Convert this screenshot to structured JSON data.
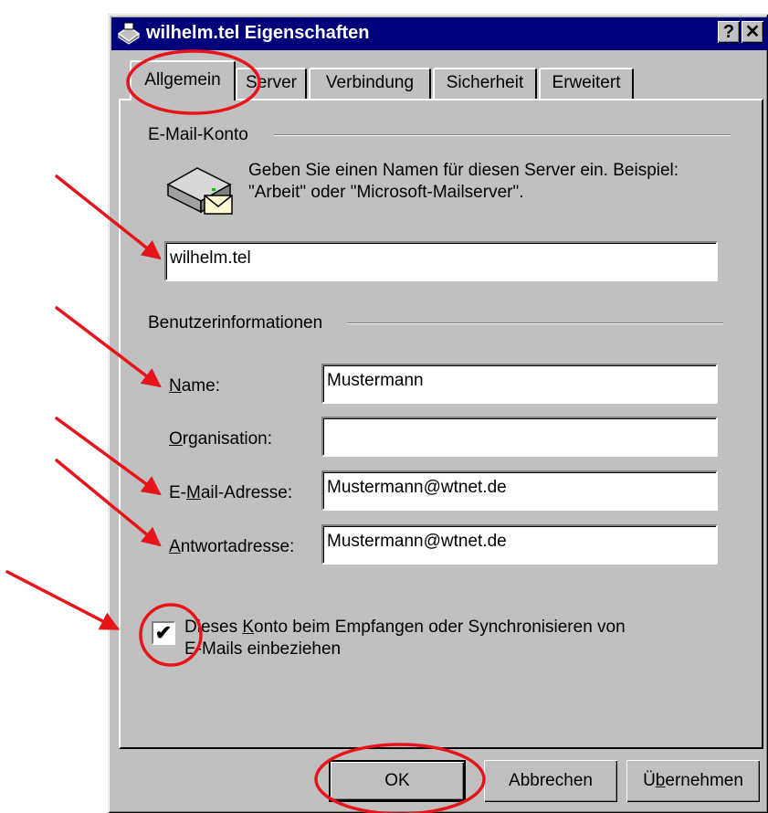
{
  "window": {
    "title": "wilhelm.tel Eigenschaften",
    "help_button": "?",
    "close_button": "✕"
  },
  "tabs": [
    {
      "label": "Allgemein"
    },
    {
      "label": "Server"
    },
    {
      "label": "Verbindung"
    },
    {
      "label": "Sicherheit"
    },
    {
      "label": "Erweitert"
    }
  ],
  "email_account": {
    "group_label": "E-Mail-Konto",
    "description_line1": "Geben Sie einen Namen für diesen Server ein. Beispiel:",
    "description_line2": "\"Arbeit\" oder \"Microsoft-Mailserver\".",
    "account_name_value": "wilhelm.tel"
  },
  "user_info": {
    "group_label": "Benutzerinformationen",
    "name_label": "Name:",
    "name_value": "Mustermann",
    "organisation_label": "Organisation:",
    "organisation_value": "",
    "email_label": "E-Mail-Adresse:",
    "email_value": "Mustermann@wtnet.de",
    "reply_label": "Antwortadresse:",
    "reply_value": "Mustermann@wtnet.de"
  },
  "include_account": {
    "checked": true,
    "label_line1": "Dieses Konto beim Empfangen oder Synchronisieren von",
    "label_line2": "E-Mails einbeziehen"
  },
  "buttons": {
    "ok": "OK",
    "cancel": "Abbrechen",
    "apply": "Übernehmen"
  },
  "colors": {
    "annotation": "#e8141c",
    "titlebar": "#00007b",
    "dialog": "#c0c0c0"
  }
}
